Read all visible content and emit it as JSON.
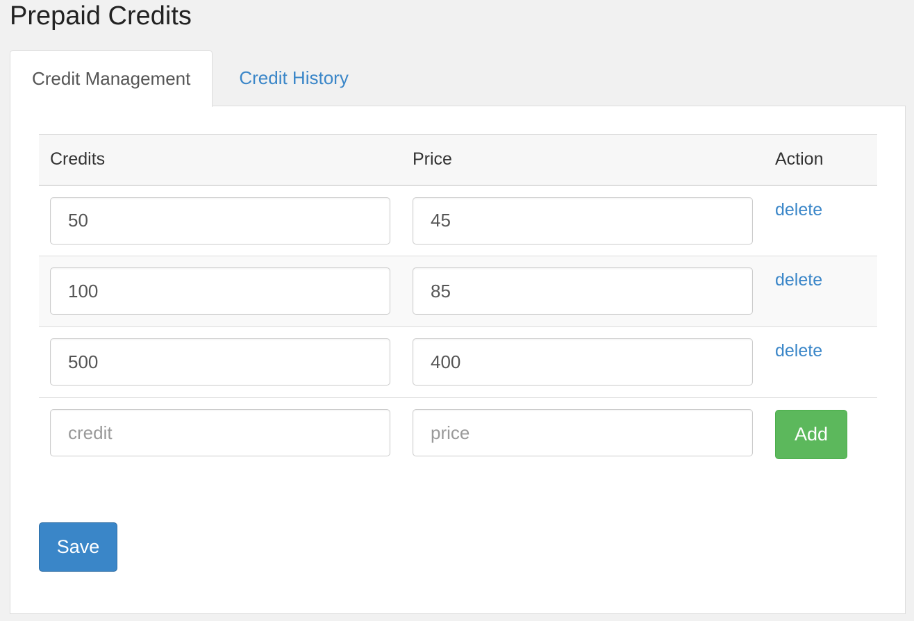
{
  "page": {
    "title": "Prepaid Credits"
  },
  "tabs": [
    {
      "label": "Credit Management",
      "active": true
    },
    {
      "label": "Credit History",
      "active": false
    }
  ],
  "table": {
    "headers": {
      "credits": "Credits",
      "price": "Price",
      "action": "Action"
    },
    "rows": [
      {
        "credits": "50",
        "price": "45",
        "action": "delete"
      },
      {
        "credits": "100",
        "price": "85",
        "action": "delete"
      },
      {
        "credits": "500",
        "price": "400",
        "action": "delete"
      }
    ],
    "new_row": {
      "credits_placeholder": "credit",
      "price_placeholder": "price",
      "add_label": "Add"
    }
  },
  "actions": {
    "save_label": "Save"
  },
  "colors": {
    "link": "#3a86c8",
    "add_button": "#5cb85c",
    "save_button": "#3a86c8",
    "background": "#f1f1f1"
  }
}
